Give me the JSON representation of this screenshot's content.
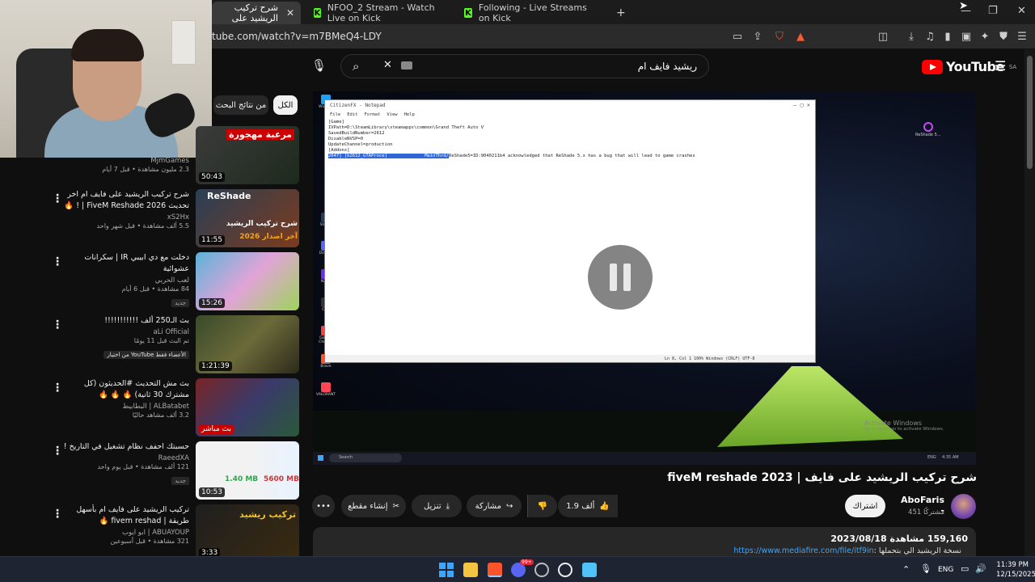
{
  "browser": {
    "tabs": [
      {
        "label": "شرح تركيب الريشيد على",
        "active": true
      },
      {
        "label": "NFOO_2 Stream - Watch Live on Kick",
        "active": false
      },
      {
        "label": "Following - Live Streams on Kick",
        "active": false
      }
    ],
    "new_tab": "+",
    "url": "tube.com/watch?v=m7BMeQ4-LDY",
    "brave_badge": "2"
  },
  "youtube": {
    "search_query": "ريشيد فايف ام",
    "logo_word": "YouTube",
    "logo_region": "SA",
    "chips": {
      "all": "الكل",
      "from_results": "من نتائج البحث"
    },
    "video": {
      "title": "شرح تركيب الريشيد على فايف | fiveM reshade 2023",
      "channel": "AboFaris -",
      "subscribers": "451 مشتركًا",
      "subscribe": "اشتراك",
      "likes": "1.9 ألف",
      "share": "مشاركة",
      "download": "تنزيل",
      "clip": "إنشاء مقطع",
      "more": "•••",
      "views_date": "159,160 مشاهدة  2023/08/18",
      "desc_prefix": "نسخة الريشيد الي بتحملها :",
      "desc_link": "https://www.mediafire.com/file/itf9in"
    },
    "recommended": [
      {
        "title": "مرعبة مهجورة",
        "channel": "MjmGames",
        "meta": "2.3 مليون مشاهدة • قبل 7 أيام",
        "duration": "50:43",
        "badge": ""
      },
      {
        "title": "شرح تركيب الريشيد على فايف ام اخر تحديث FiveM Reshade 2026 | ! 🔥",
        "channel": "xS2Hx",
        "meta": "5.5 ألف مشاهدة • قبل شهر واحد",
        "duration": "11:55",
        "badge": ""
      },
      {
        "title": "دخلت مع دي ابيبي IR | سكرانات عشوائية",
        "channel": "لعب الحربي",
        "meta": "84 مشاهدة • قبل 6 أيام",
        "duration": "15:26",
        "badge": "جديد"
      },
      {
        "title": "بث الـ250 ألف !!!!!!!!!!!",
        "channel": "aLi Official",
        "meta": "تم البث قبل 11 يومًا",
        "duration": "1:21:39",
        "badge": "الأعضاء فقط  YouTube من اختيار"
      },
      {
        "title": "بث مش التحديث #الحديثون (كل مشترك 30 ثانية) 🔥 🔥 🔥",
        "channel": "ALBatabet | البطابيط",
        "meta": "3.2 ألف مشاهد حاليًا",
        "duration": "بث مباشر",
        "badge": ""
      },
      {
        "title": "حسبتك احفف نظام تشغيل في التاريخ !",
        "channel": "RaeedXA",
        "meta": "121 ألف مشاهدة • قبل يوم واحد",
        "duration": "10:53",
        "badge": "جديد"
      },
      {
        "title": "تركيب الريشيد على فايف ام بأسهل طريقة | fivem reshad 🔥",
        "channel": "ABUAYOUP | ابو ايوب",
        "meta": "321 مشاهدة • قبل أسبوعين",
        "duration": "3:33",
        "badge": ""
      }
    ],
    "thumb_texts": {
      "t0": "مرعبة مهجورة",
      "t1": "ReShade",
      "t1b": "شرح تركيب الريشيد",
      "t1c": "آخر اصدار 2026",
      "t5a": "1.40 MB",
      "t5b": "5600 MB",
      "t6": "تركيب ريشيد"
    }
  },
  "notepad": {
    "title": "CitizenFX - Notepad",
    "menu": [
      "File",
      "Edit",
      "Format",
      "View",
      "Help"
    ],
    "lines": [
      "[Game]",
      "IVPath=D:\\SteamLibrary\\steamapps\\common\\Grand Theft Auto V",
      "SavedBuildNumber=2612",
      "",
      "DisableNVSP=0",
      "UpdateChannel=production",
      "",
      "[Addons]"
    ],
    "highlight": "2047] [b2612_GTAProce]              MainThrd/",
    "after_highlight": "ReShade5=ID:9040211b4 acknowledged that ReShade 5.x has a bug that will lead to game crashes",
    "status": "Ln 8, Col 1        100%    Windows (CRLF)    UTF-8",
    "activate": "Activate Windows",
    "activate_sub": "Go to Settings to activate Windows.",
    "desktop_icons": [
      "Window",
      "Steam",
      "Discord",
      "NZXT",
      "OBS",
      "Google Chrome",
      "Brave",
      "VALORANT"
    ],
    "reshade_label": "ReShade 5...",
    "search": "Search",
    "time": "4:35 AM",
    "lang": "ENG"
  },
  "taskbar": {
    "lang": "ENG",
    "time": "11:39 PM",
    "date": "12/15/2025",
    "discord_badge": "99+"
  },
  "colors": {
    "accent": "#ff0000",
    "kick": "#53fc18",
    "link": "#3ea6ff",
    "highlight": "#3066d6"
  }
}
